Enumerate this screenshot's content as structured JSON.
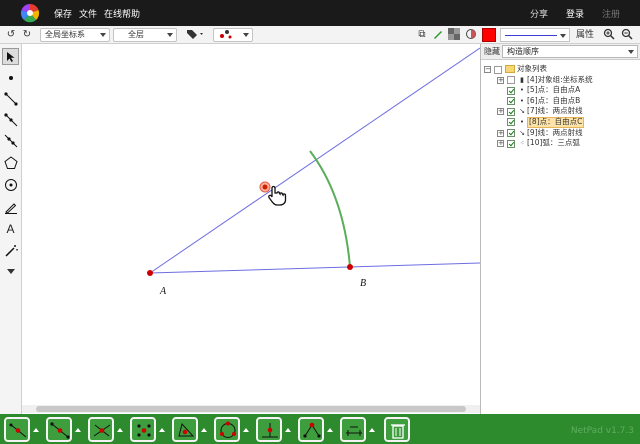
{
  "menu": {
    "save": "保存",
    "file": "文件",
    "online_help": "在线帮助"
  },
  "account": {
    "share": "分享",
    "login": "登录",
    "register": "注册"
  },
  "toolbar": {
    "coord_system": "全局坐标系",
    "layer": "全层",
    "attribute": "属性",
    "line_color": "#3b3bd6",
    "fill_color": "#ff0000"
  },
  "canvas": {
    "points": [
      {
        "label": "A"
      },
      {
        "label": "B"
      }
    ],
    "colors": {
      "ray": "#6d6de0",
      "arc": "#5aae5a",
      "point": "#cc0000"
    }
  },
  "panel": {
    "hide_label": "隐藏",
    "order": "构造顺序",
    "tree": [
      {
        "text": "对象列表",
        "type": "root"
      },
      {
        "text": "[4]对象组:坐标系统",
        "type": "group",
        "checked": false
      },
      {
        "text": "[5]点：自由点A",
        "type": "point",
        "checked": true
      },
      {
        "text": "[6]点：自由点B",
        "type": "point",
        "checked": true
      },
      {
        "text": "[7]线：两点射线",
        "type": "ray",
        "checked": true
      },
      {
        "text": "[8]点：自由点C",
        "type": "point",
        "checked": true,
        "highlight": true
      },
      {
        "text": "[9]线：两点射线",
        "type": "ray",
        "checked": true
      },
      {
        "text": "[10]弧：三点弧",
        "type": "arc",
        "checked": true
      }
    ]
  },
  "footer": {
    "brand": "NetPad v1.7.3"
  }
}
